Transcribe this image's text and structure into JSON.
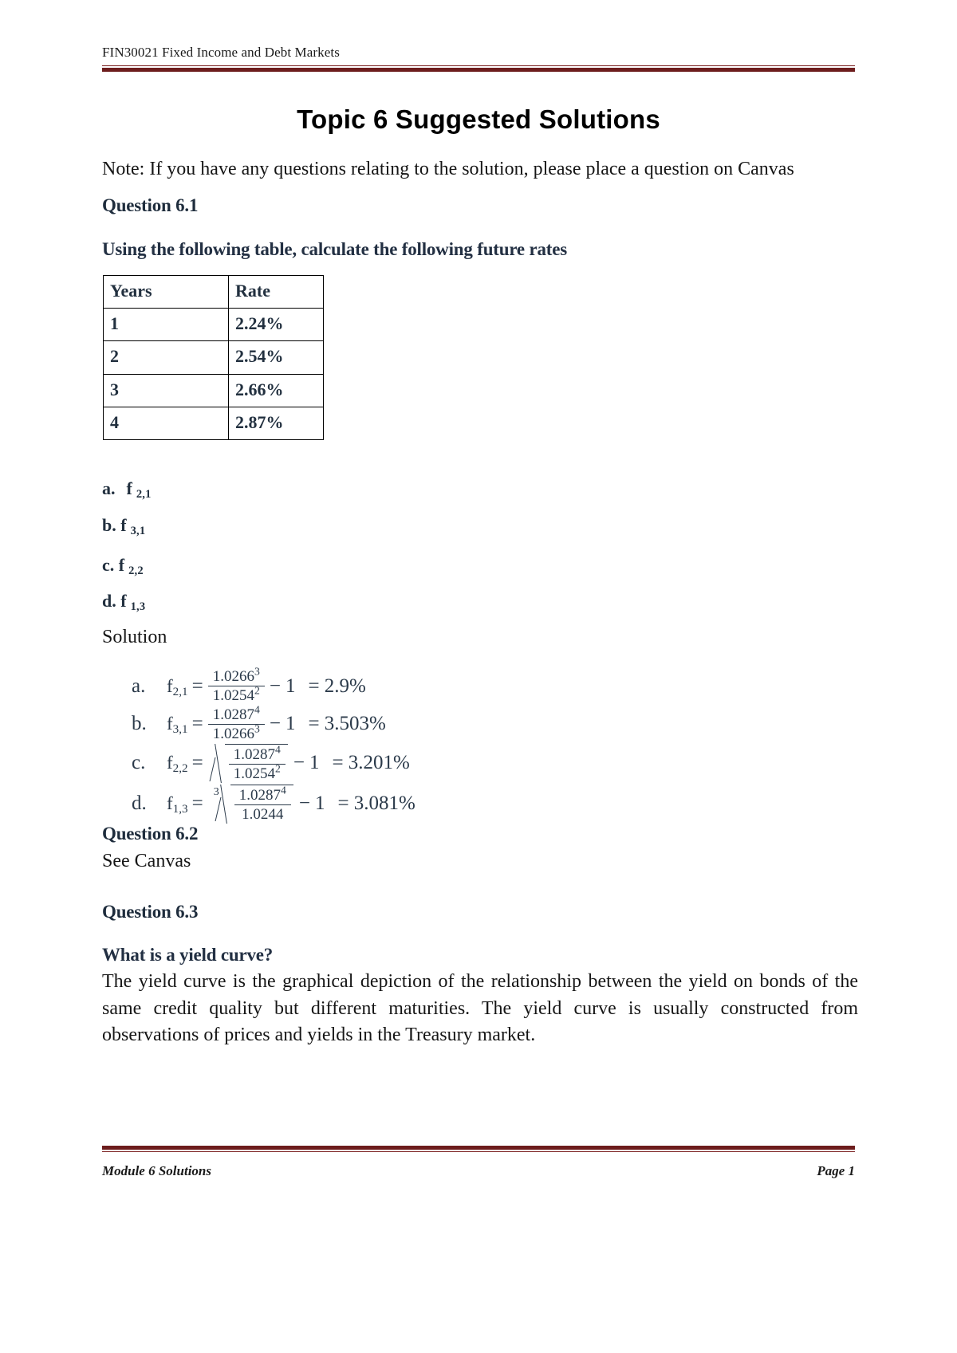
{
  "header": {
    "course_title": "FIN30021 Fixed Income and Debt Markets",
    "rule_color": "#6d1d1d"
  },
  "document": {
    "title": "Topic 6 Suggested Solutions",
    "note": "Note: If you have any questions relating to the solution, please place a question on Canvas"
  },
  "question_61": {
    "heading": "Question 6.1",
    "subheading": "Using the following table, calculate the following future rates",
    "table": {
      "headers": [
        "Years",
        "Rate"
      ],
      "rows": [
        [
          "1",
          "2.24%"
        ],
        [
          "2",
          "2.54%"
        ],
        [
          "3",
          "2.66%"
        ],
        [
          "4",
          "2.87%"
        ]
      ]
    },
    "items": [
      {
        "letter": "a.",
        "symbol": "f",
        "subscript": "2,1"
      },
      {
        "letter": "b.",
        "symbol": "f",
        "subscript": "3,1"
      },
      {
        "letter": "c.",
        "symbol": "f",
        "subscript": "2,2"
      },
      {
        "letter": "d.",
        "symbol": "f",
        "subscript": "1,3"
      }
    ],
    "solution_label": "Solution",
    "equations": [
      {
        "letter": "a.",
        "lhs_symbol": "f",
        "lhs_subscript": "2,1",
        "equals": "=",
        "root": "none",
        "root_index": "",
        "numerator": "1.0266",
        "numerator_exp": "3",
        "denominator": "1.0254",
        "denominator_exp": "2",
        "minus": "−",
        "one": "1",
        "result": "= 2.9%"
      },
      {
        "letter": "b.",
        "lhs_symbol": "f",
        "lhs_subscript": "3,1",
        "equals": "=",
        "root": "none",
        "root_index": "",
        "numerator": "1.0287",
        "numerator_exp": "4",
        "denominator": "1.0266",
        "denominator_exp": "3",
        "minus": "−",
        "one": "1",
        "result": "= 3.503%"
      },
      {
        "letter": "c.",
        "lhs_symbol": "f",
        "lhs_subscript": "2,2",
        "equals": "=",
        "root": "square",
        "root_index": "",
        "numerator": "1.0287",
        "numerator_exp": "4",
        "denominator": "1.0254",
        "denominator_exp": "2",
        "minus": "−",
        "one": "1",
        "result": "= 3.201%"
      },
      {
        "letter": "d.",
        "lhs_symbol": "f",
        "lhs_subscript": "1,3",
        "equals": "=",
        "root": "indexed",
        "root_index": "3",
        "numerator": "1.0287",
        "numerator_exp": "4",
        "denominator": "1.0244",
        "denominator_exp": "",
        "minus": "−",
        "one": "1",
        "result": "= 3.081%"
      }
    ]
  },
  "question_62": {
    "heading": "Question 6.2",
    "body": "See Canvas"
  },
  "question_63": {
    "heading": "Question 6.3",
    "subheading": "What is a yield curve?",
    "body": "The yield curve is the graphical depiction of the relationship between the yield on bonds of the same credit quality but different maturities. The yield curve is usually constructed from observations of prices and yields in the Treasury market."
  },
  "footer": {
    "left": "Module 6 Solutions",
    "right": "Page 1"
  }
}
